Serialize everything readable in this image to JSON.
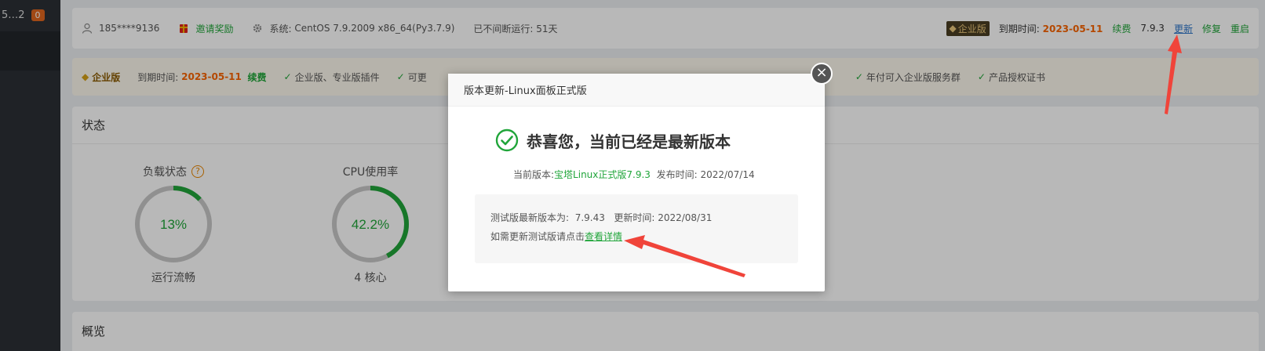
{
  "sidebar": {
    "title": "5…2",
    "badge": "0"
  },
  "topbar": {
    "user": "185****9136",
    "invite": "邀请奖励",
    "system_label": "系统:",
    "system_value": "CentOS 7.9.2009 x86_64(Py3.7.9)",
    "uptime": "已不间断运行: 51天",
    "edition": "企业版",
    "expire_label": "到期时间:",
    "expire_date": "2023-05-11",
    "renew": "续费",
    "version": "7.9.3",
    "update": "更新",
    "repair": "修复",
    "restart": "重启"
  },
  "vip": {
    "title": "企业版",
    "expire_label": "到期时间:",
    "expire_date": "2023-05-11",
    "renew": "续费",
    "perks": [
      "企业版、专业版插件",
      "可更",
      "年付可入企业版服务群",
      "产品授权证书"
    ]
  },
  "status": {
    "heading": "状态",
    "load": {
      "title": "负载状态",
      "help": "?",
      "value": "13%",
      "fraction": 0.13,
      "sub": "运行流畅"
    },
    "cpu": {
      "title": "CPU使用率",
      "value": "42.2%",
      "fraction": 0.422,
      "sub": "4 核心"
    }
  },
  "overview": {
    "heading": "概览"
  },
  "modal": {
    "title": "版本更新-Linux面板正式版",
    "close": "×",
    "heading": "恭喜您，当前已经是最新版本",
    "current_label": "当前版本:",
    "current_value": "宝塔Linux正式版7.9.3",
    "release_label": "发布时间:",
    "release_date": "2022/07/14",
    "beta_label": "测试版最新版本为:",
    "beta_version": "7.9.43",
    "beta_time_label": "更新时间:",
    "beta_time": "2022/08/31",
    "beta_hint": "如需更新测试版请点击",
    "beta_link": "查看详情"
  },
  "colors": {
    "accent": "#20a53a",
    "warning": "#fa6400",
    "arrow": "#f0443a"
  }
}
